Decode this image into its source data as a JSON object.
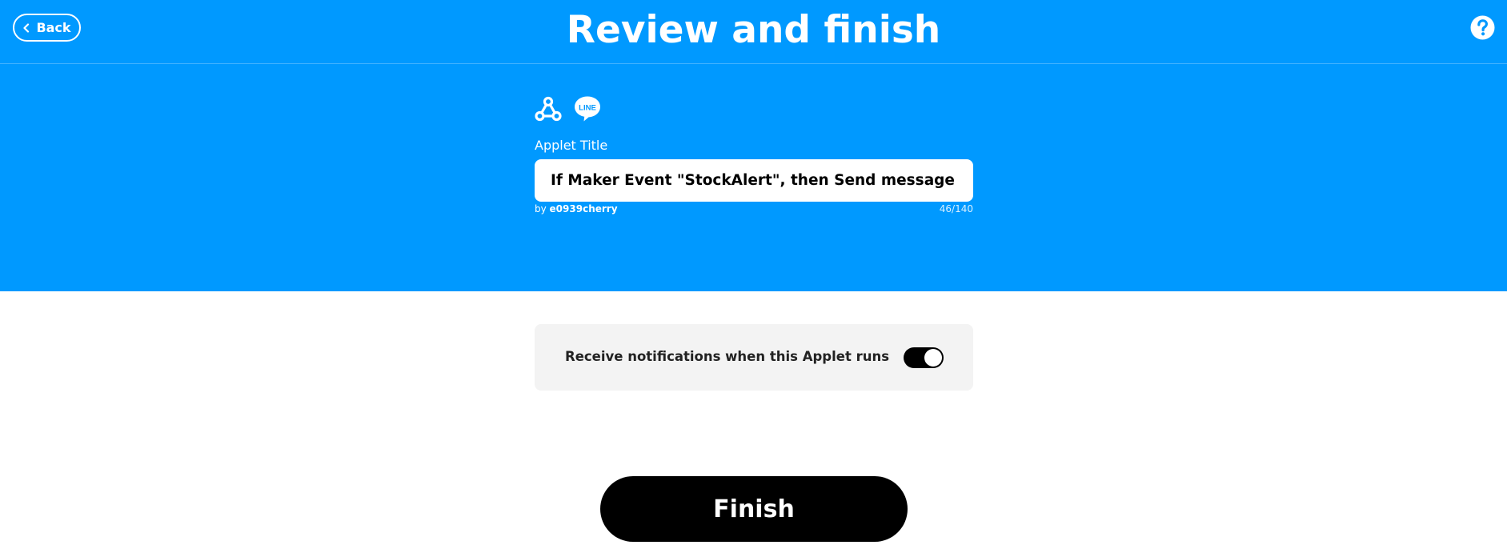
{
  "header": {
    "back_label": "Back",
    "title": "Review and finish"
  },
  "applet": {
    "services": [
      "webhook-icon",
      "line-icon"
    ],
    "line_icon_text": "LINE",
    "title_label": "Applet Title",
    "title_value": "If Maker Event \"StockAlert\", then Send message",
    "author_prefix": "by",
    "author_name": "e0939cherry",
    "char_count": "46/140"
  },
  "notifications": {
    "label": "Receive notifications when this Applet runs",
    "enabled": true
  },
  "finish_label": "Finish",
  "colors": {
    "hero_background": "#0099ff",
    "button_background": "#000000",
    "card_background": "#f3f3f3"
  }
}
